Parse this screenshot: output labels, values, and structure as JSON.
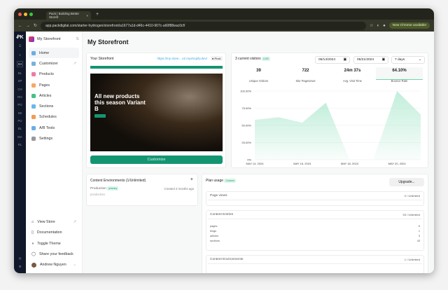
{
  "browser": {
    "tab_title": "Pack | Building Better Storefr",
    "url": "app.packdigital.com/starter-hydrogen/storefront/a1677a1d-d46c-4410-907c-a60f88eac0cf/",
    "new_chrome": "New Chrome available"
  },
  "rail": {
    "logo": "PACK",
    "items": [
      "SH",
      "BL",
      "SP",
      "CH",
      "RO",
      "PO",
      "SE",
      "PU",
      "BL",
      "MA",
      "RL"
    ]
  },
  "sidebar": {
    "store": "My Storefront",
    "items": [
      {
        "label": "Home",
        "color": "#6aaee8"
      },
      {
        "label": "Customizer",
        "color": "#7ab0e0"
      },
      {
        "label": "Products",
        "color": "#f07aa0"
      },
      {
        "label": "Pages",
        "color": "#f6a860"
      },
      {
        "label": "Articles",
        "color": "#45c08a"
      },
      {
        "label": "Sections",
        "color": "#6ab8ee"
      },
      {
        "label": "Schedules",
        "color": "#f59a55"
      },
      {
        "label": "A/B Tests",
        "color": "#6aaee8"
      },
      {
        "label": "Settings",
        "color": "#999999"
      }
    ],
    "bottom": [
      "View Store",
      "Documentation",
      "Toggle Theme",
      "Share your feedback"
    ],
    "user": "Andrew Nguyen"
  },
  "page": {
    "title": "My Storefront"
  },
  "storefront": {
    "title": "Your Storefront",
    "link": "https://my-store…o2.myshopify.dev/",
    "env": "Prod.",
    "hero": "All new products this season Variant B",
    "customize": "Customize"
  },
  "analytics": {
    "visitors": "3 current visitors",
    "live": "LIVE",
    "from": "05/14/2024",
    "to": "05/21/2024",
    "range": "7 days",
    "stats": [
      {
        "value": "39",
        "label": "Unique Visitors"
      },
      {
        "value": "722",
        "label": "Site Pageviews"
      },
      {
        "value": "24m 37s",
        "label": "Avg. Visit Time"
      },
      {
        "value": "64.10%",
        "label": "Bounce Rate"
      }
    ]
  },
  "chart_data": {
    "type": "area",
    "title": "Bounce Rate",
    "x": [
      "MAY 14, 2024",
      "MAY 15, 2024",
      "MAY 16, 2024",
      "MAY 17, 2024",
      "MAY 18, 2024",
      "MAY 19, 2024",
      "MAY 20, 2024",
      "MAY 21, 2024"
    ],
    "values": [
      58,
      62,
      54,
      83,
      0,
      0,
      100,
      66
    ],
    "xticks": [
      "MAY 14, 2024",
      "MAY 16, 2024",
      "MAY 18, 2024",
      "MAY 20, 2024"
    ],
    "yticks": [
      "0%",
      "25.00%",
      "50.00%",
      "75.00%",
      "100.00%"
    ],
    "ylim": [
      0,
      100
    ],
    "color": "#8fe0bd"
  },
  "environments": {
    "title": "Content Environments (1/Unlimited)",
    "add": "+",
    "name": "Production",
    "badge": "primary",
    "slug": "production",
    "created": "Created 2 months ago"
  },
  "plan": {
    "title": "Plan usage",
    "badge": "Custom",
    "upgrade": "Upgrade...",
    "page_views": {
      "label": "Page views",
      "value": "0 / Unlimited"
    },
    "entries": {
      "label": "Content Entries",
      "value": "53 / Unlimited",
      "rows": [
        {
          "k": "pages",
          "v": "6"
        },
        {
          "k": "blogs",
          "v": "1"
        },
        {
          "k": "articles",
          "v": "3"
        },
        {
          "k": "sections",
          "v": "43"
        }
      ]
    },
    "envs": {
      "label": "Content Environments",
      "value": "1 / Unlimited"
    }
  }
}
